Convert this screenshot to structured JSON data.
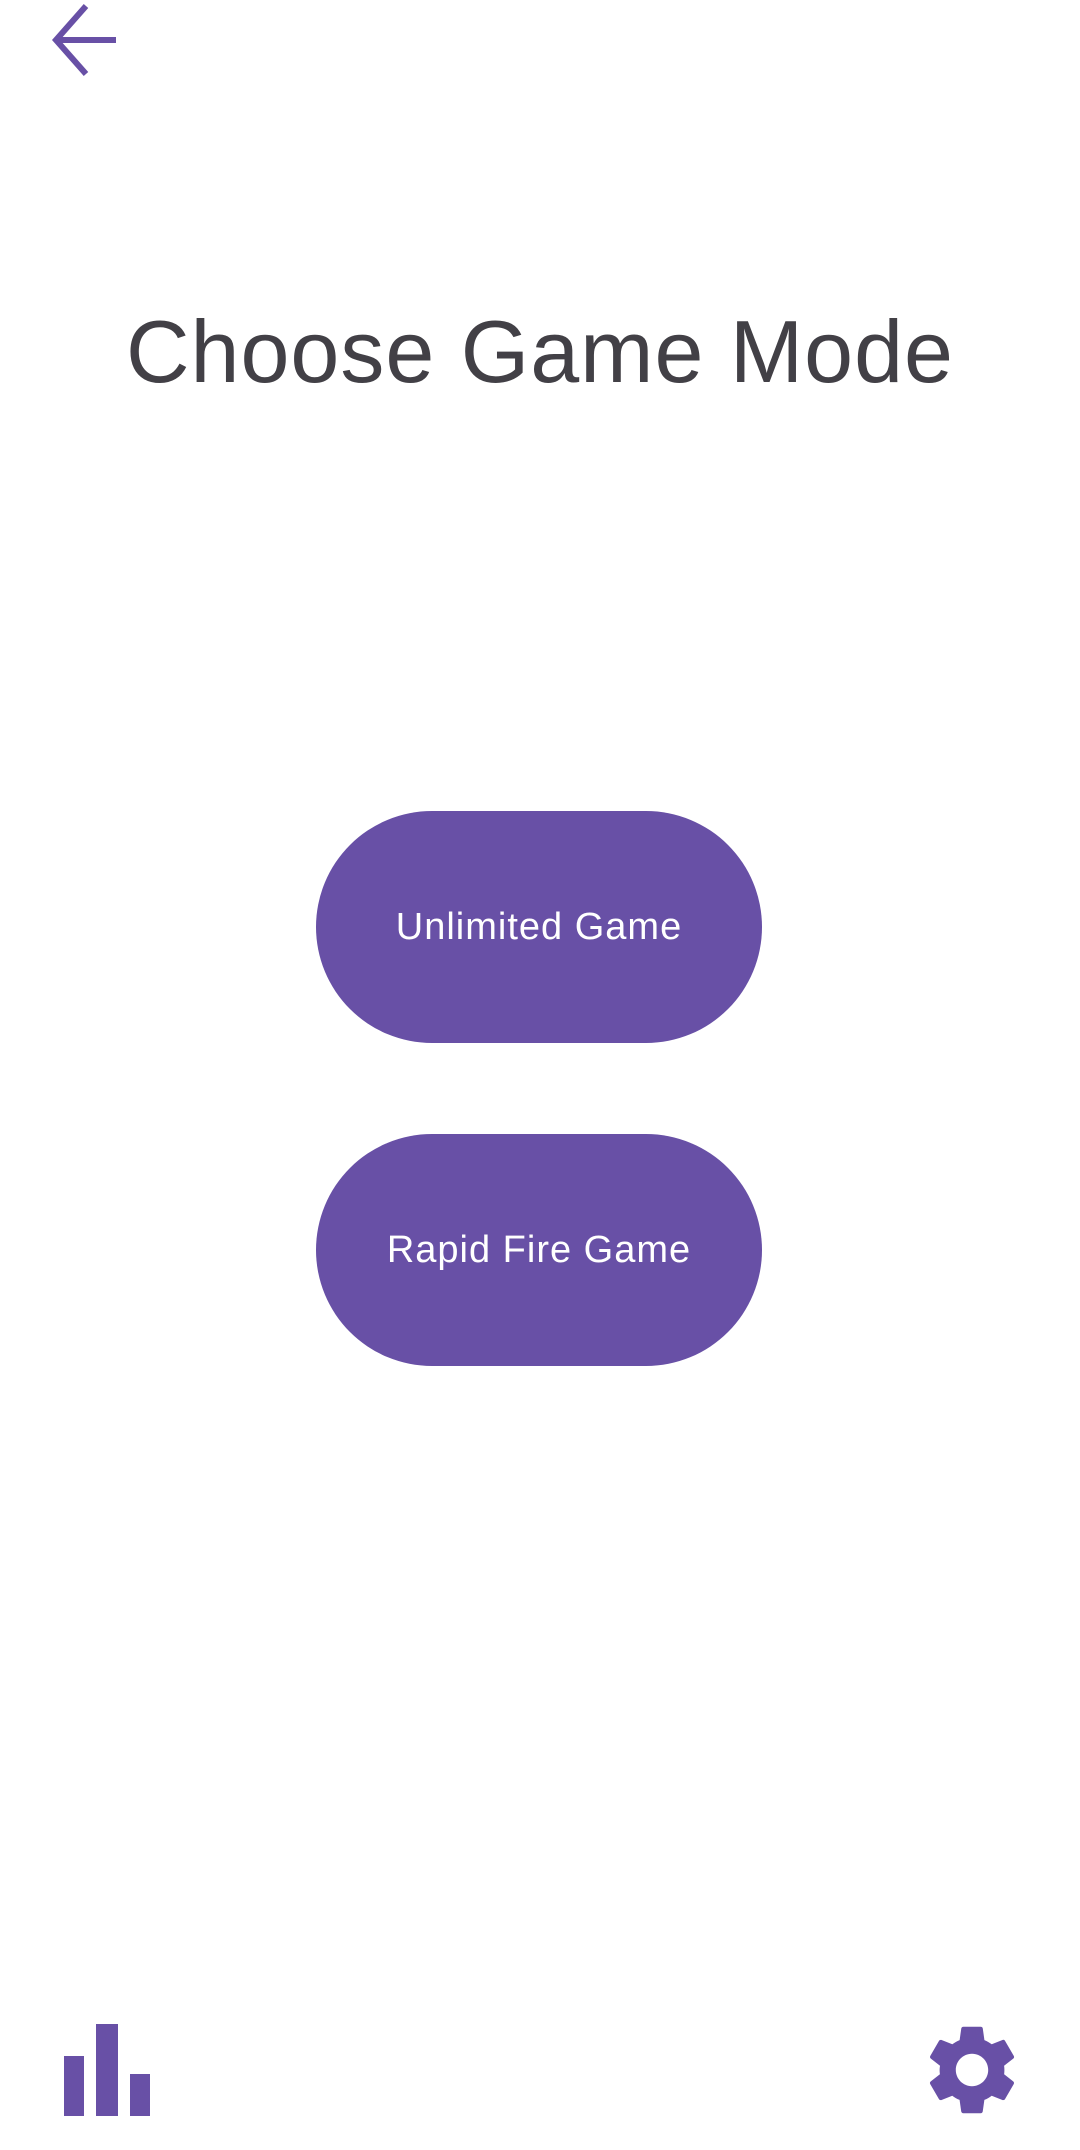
{
  "header": {
    "back_icon": "arrow-left-icon",
    "title": "Choose Game Mode"
  },
  "modes": {
    "unlimited_label": "Unlimited Game",
    "rapid_fire_label": "Rapid Fire Game"
  },
  "footer": {
    "stats_icon": "bar-chart-icon",
    "settings_icon": "gear-icon"
  },
  "colors": {
    "accent": "#6850a6",
    "title_text": "#424046",
    "button_text": "#ffffff",
    "background": "#ffffff"
  }
}
